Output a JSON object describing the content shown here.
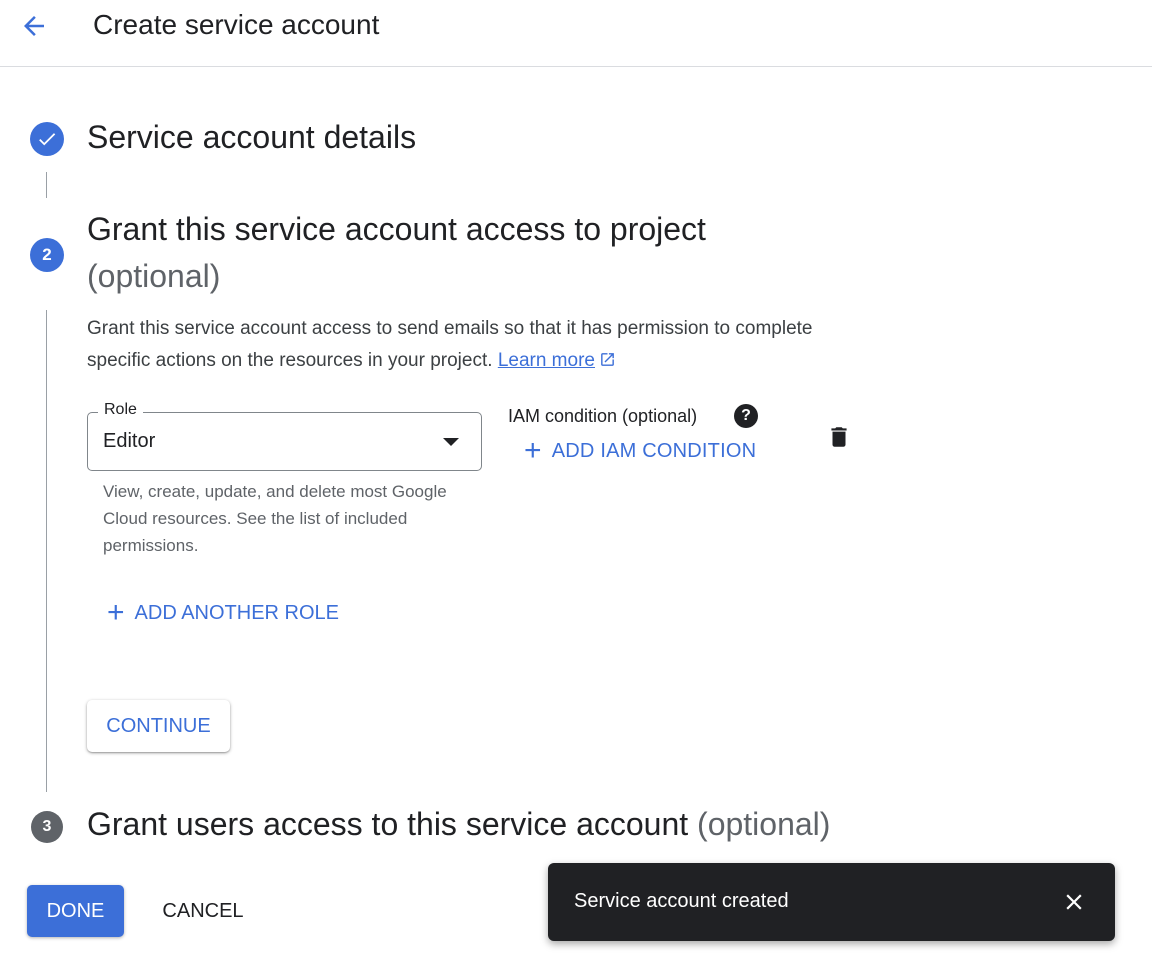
{
  "header": {
    "title": "Create service account"
  },
  "steps": {
    "step1": {
      "title": "Service account details"
    },
    "step2": {
      "number": "2",
      "title": "Grant this service account access to project",
      "optional": "(optional)",
      "description": "Grant this service account access to send emails so that it has permission to complete specific actions on the resources in your project.",
      "learn_more": "Learn more",
      "role": {
        "label": "Role",
        "value": "Editor",
        "help": "View, create, update, and delete most Google Cloud resources. See the list of included permissions."
      },
      "iam_condition": {
        "label": "IAM condition (optional)",
        "help_glyph": "?",
        "add_label": "ADD IAM CONDITION"
      },
      "add_another_role": "ADD ANOTHER ROLE",
      "continue_label": "CONTINUE"
    },
    "step3": {
      "number": "3",
      "title": "Grant users access to this service account",
      "optional": "(optional)"
    }
  },
  "footer": {
    "done_label": "DONE",
    "cancel_label": "CANCEL"
  },
  "snackbar": {
    "message": "Service account created"
  },
  "icons": {
    "back": "arrow-left-icon",
    "step1": "check-circle-icon",
    "external": "external-link-icon",
    "help": "help-icon",
    "add": "plus-icon",
    "delete": "trash-icon",
    "close": "close-icon"
  },
  "colors": {
    "accent": "#3c6fd8",
    "text": "#202124",
    "muted": "#5f6368",
    "snackbar": "#202124"
  }
}
